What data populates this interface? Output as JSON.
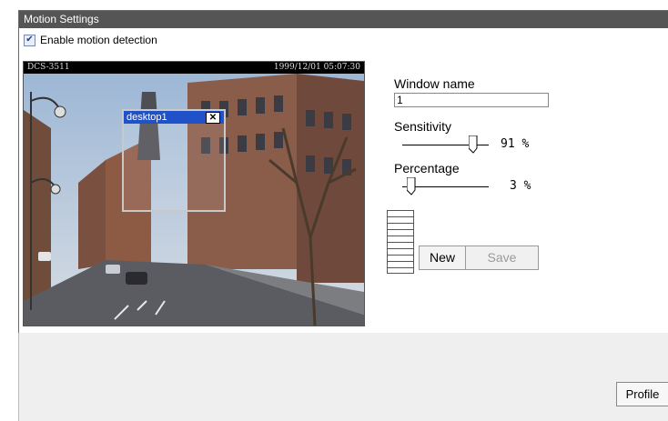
{
  "panel": {
    "title": "Motion Settings",
    "enable_label": "Enable motion detection",
    "enable_checked": true
  },
  "camera": {
    "model": "DCS-3511",
    "timestamp": "1999/12/01 05:07:30",
    "motion_window_title": "desktop1",
    "close_glyph": "✕"
  },
  "settings": {
    "window_name_label": "Window name",
    "window_name_value": "1",
    "sensitivity_label": "Sensitivity",
    "sensitivity_value": 91,
    "sensitivity_display": "91 %",
    "percentage_label": "Percentage",
    "percentage_value": 3,
    "percentage_display": "3 %"
  },
  "buttons": {
    "new_label": "New",
    "save_label": "Save",
    "profile_label": "Profile"
  },
  "icons": {
    "checkbox": "check-icon",
    "close": "close-icon"
  },
  "colors": {
    "title_bar": "#555555",
    "motion_window_title": "#1f52c8"
  }
}
